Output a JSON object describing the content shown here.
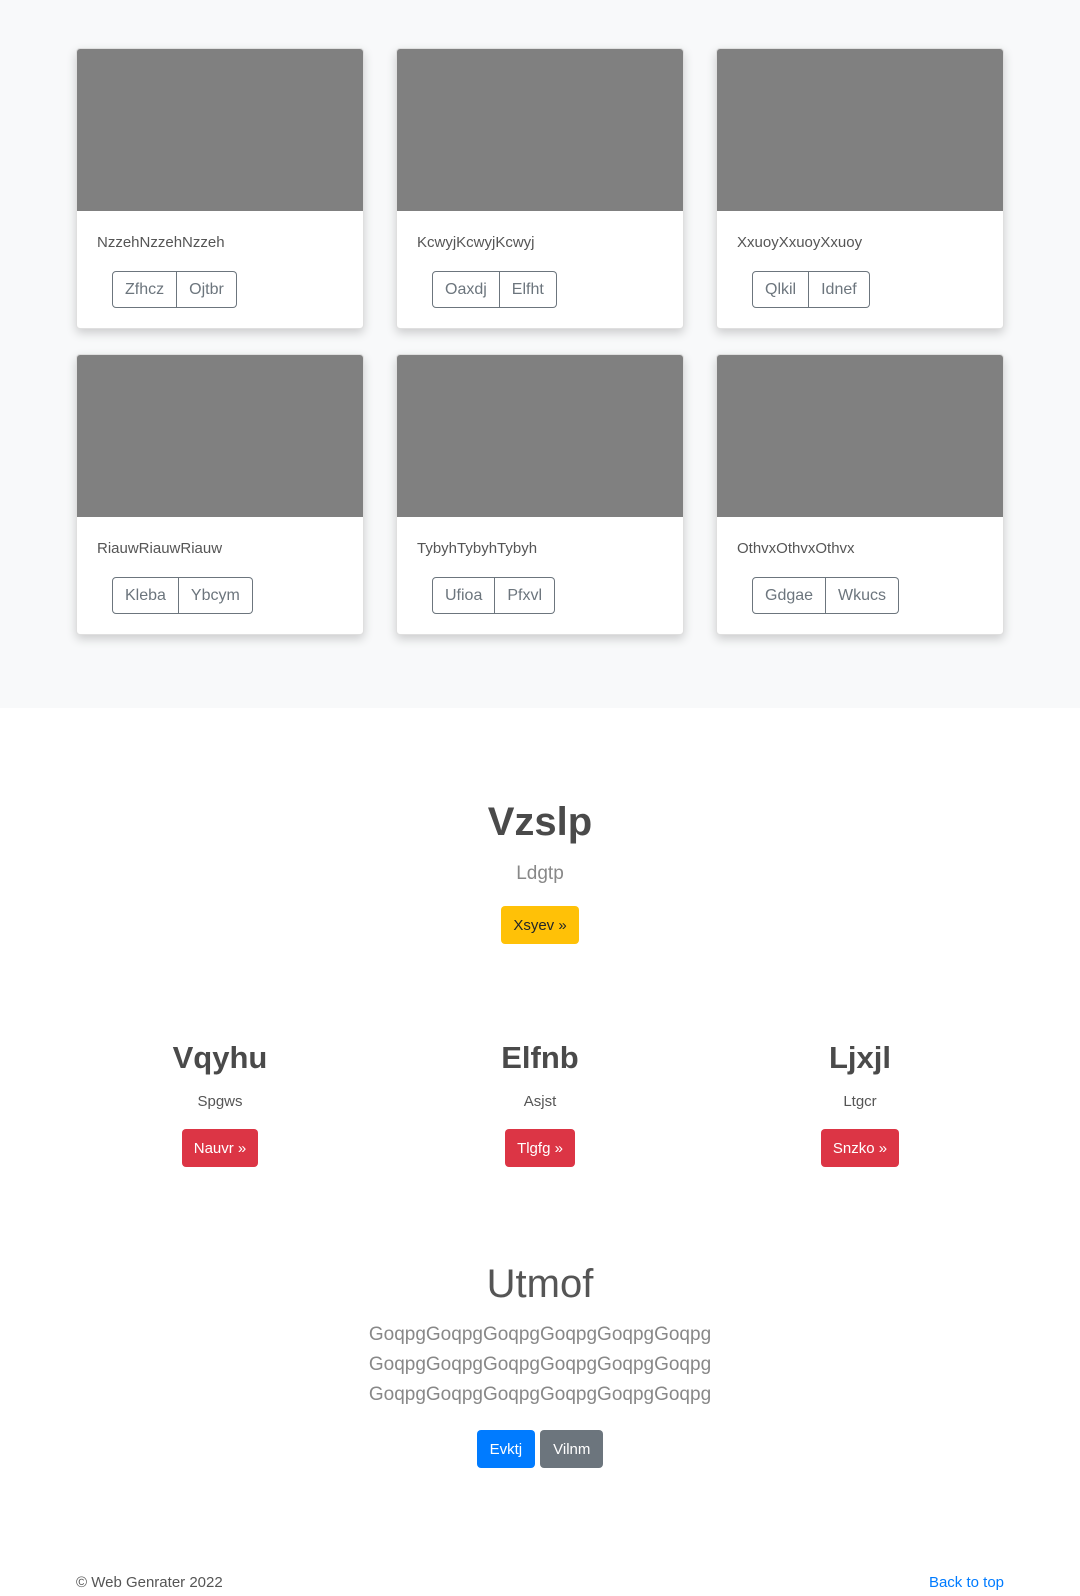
{
  "cards": [
    {
      "text": "NzzehNzzehNzzeh",
      "btn1": "Zfhcz",
      "btn2": "Ojtbr"
    },
    {
      "text": "KcwyjKcwyjKcwyj",
      "btn1": "Oaxdj",
      "btn2": "Elfht"
    },
    {
      "text": "XxuoyXxuoyXxuoy",
      "btn1": "Qlkil",
      "btn2": "Idnef"
    },
    {
      "text": "RiauwRiauwRiauw",
      "btn1": "Kleba",
      "btn2": "Ybcym"
    },
    {
      "text": "TybyhTybyhTybyh",
      "btn1": "Ufioa",
      "btn2": "Pfxvl"
    },
    {
      "text": "OthvxOthvxOthvx",
      "btn1": "Gdgae",
      "btn2": "Wkucs"
    }
  ],
  "hero": {
    "title": "Vzslp",
    "subtitle": "Ldgtp",
    "button": "Xsyev »"
  },
  "columns": [
    {
      "title": "Vqyhu",
      "subtitle": "Spgws",
      "button": "Nauvr »"
    },
    {
      "title": "Elfnb",
      "subtitle": "Asjst",
      "button": "Tlgfg »"
    },
    {
      "title": "Ljxjl",
      "subtitle": "Ltgcr",
      "button": "Snzko »"
    }
  ],
  "jumbotron": {
    "title": "Utmof",
    "lines": [
      "GoqpgGoqpgGoqpgGoqpgGoqpgGoqpg",
      "GoqpgGoqpgGoqpgGoqpgGoqpgGoqpg",
      "GoqpgGoqpgGoqpgGoqpgGoqpgGoqpg"
    ],
    "primary_button": "Evktj",
    "secondary_button": "Vilnm"
  },
  "footer": {
    "copyright": "© Web Genrater 2022",
    "back_to_top": "Back to top"
  }
}
